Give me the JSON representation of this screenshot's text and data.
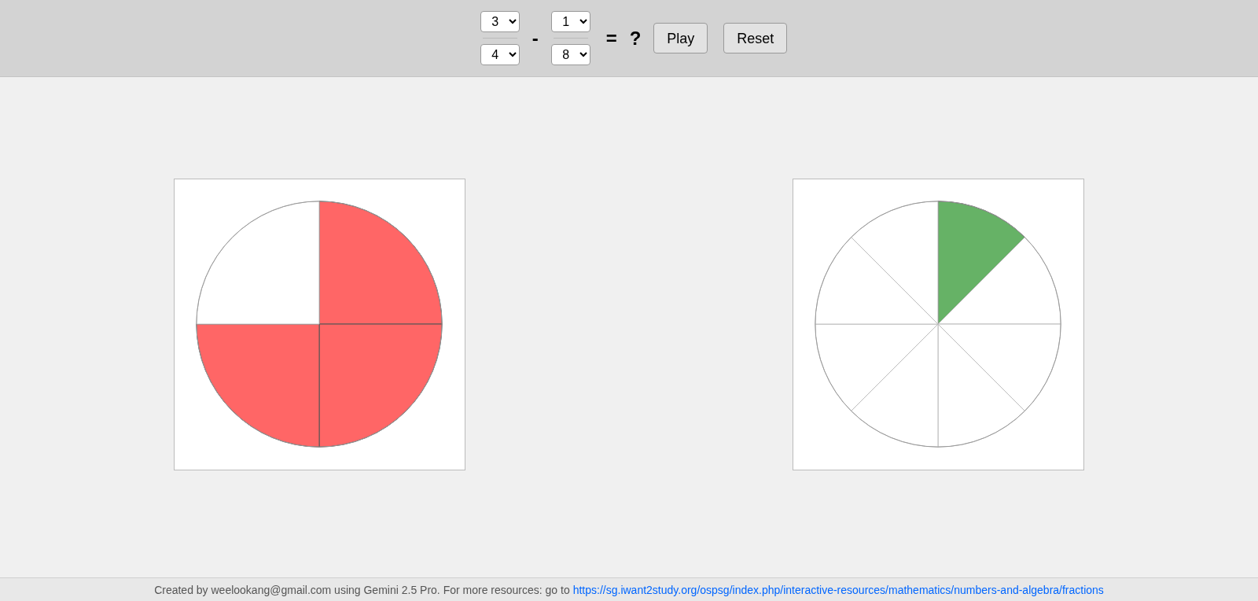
{
  "equation": {
    "first": {
      "numerator": "3",
      "denominator": "4"
    },
    "operator": "-",
    "second": {
      "numerator": "1",
      "denominator": "8"
    },
    "equals": "=",
    "result": "?"
  },
  "buttons": [
    {
      "label": "Play"
    },
    {
      "label": "Reset"
    }
  ],
  "pies": [
    {
      "color": "#ff6666",
      "sectors": [
        {
          "shaded": true
        },
        {
          "shaded": true
        },
        {
          "shaded": true
        },
        {
          "shaded": false
        }
      ]
    },
    {
      "color": "#66b266",
      "sectors": [
        {
          "shaded": true
        },
        {
          "shaded": false
        },
        {
          "shaded": false
        },
        {
          "shaded": false
        },
        {
          "shaded": false
        },
        {
          "shaded": false
        },
        {
          "shaded": false
        },
        {
          "shaded": false
        }
      ]
    }
  ],
  "footer": {
    "text": "Created by weelookang@gmail.com using Gemini 2.5 Pro. For more resources: go to",
    "link": "https://sg.iwant2study.org/ospsg/index.php/interactive-resources/mathematics/numbers-and-algebra/fractions"
  }
}
